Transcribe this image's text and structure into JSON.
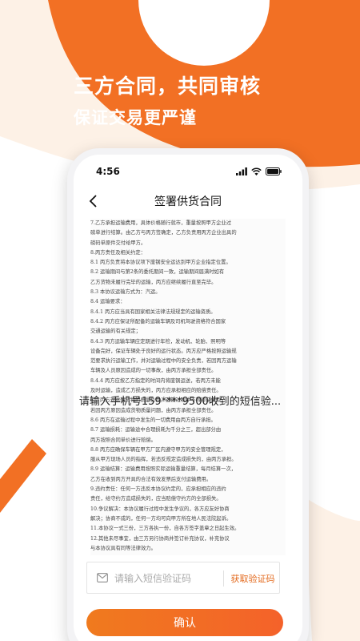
{
  "banner": {
    "headline": "三方合同，共同审核",
    "subline": "保证交易更严谨"
  },
  "status_bar": {
    "time": "4:56"
  },
  "nav": {
    "title": "签署供货合同"
  },
  "document": {
    "lines": [
      "7.乙方承担运输费用，具体价格随行就市，重量按照甲方企业过",
      "磅单进行结算。由乙方与丙方签确定，乙方负责用丙方企业出具的",
      "磅码单原件交付给甲方。",
      "8.丙方责任及相关约定：",
      "8.1 丙方负责将本协议项下废钢安全运达到甲方企业指定位置。",
      "8.2 运输期间与第2条的委托期间一致，运输期间届满时如有",
      "乙方货物未履行完毕的运输，丙方应继续履行直至完毕。",
      "8.3 本协议运输方式为：汽运。",
      "8.4 运输要求：",
      "8.4.1 丙方应当具有国家相关法律法规规定的运输资质。",
      "8.4.2 丙方应保证所配备的运输车辆及司机驾驶资格符合国家",
      "交通运输的有关规定；",
      "8.4.3 丙方运输车辆应定期进行年检，发动机、轮胎、照明等",
      "设备完好，保证车辆处于良好的运行状态。丙方应严格按照运输规",
      "范要求执行运输工作，并对运输过程中的安全负责，若因丙方运输",
      "车辆及人员原因造成的一切事故，由丙方承担全部责任。",
      "8.4.4 丙方应按乙方指定的时间内将废钢运送，若丙方未能",
      "及时运输，造成乙方损失的，丙方应承担相应的赔偿责任。",
      "8.5 丙方对运输货物的质量负责，运输过程中不得掺杂使假，",
      "若因丙方原因造成货物质量问题，由丙方承担全部责任。",
      "8.6 丙方在运输过程中发生的一切费用由丙方自行承担。",
      "8.7 运输损耗：运输途中合理损耗为千分之三，超出部分由",
      "丙方按照合同单价进行赔偿。",
      "8.8 丙方应确保车辆在甲方厂区内遵守甲方的安全管理规定，",
      "服从甲方现场人员的指挥，若违反规定造成损失的，由丙方承担。",
      "8.9 运输结算：运输费用按照实际运输重量结算，每月结算一次，",
      "乙方在收到丙方开具的合法有效发票后支付运输费用。",
      "9.违约责任：任何一方违反本协议约定的，应承担相应的违约",
      "责任，给守约方造成损失的，应当赔偿守约方的全部损失。",
      "10.争议解决：本协议履行过程中发生争议的，各方应友好协商",
      "解决；协商不成的，任何一方均可向甲方所在地人民法院起诉。",
      "11.本协议一式三份，三方各执一份，自各方签字盖章之日起生效。",
      "12.其他未尽事宜，由三方另行协商并签订补充协议，补充协议",
      "与本协议具有同等法律效力。"
    ]
  },
  "sms": {
    "prompt": "请输入手机号159****9500收到的短信验...",
    "placeholder": "请输入短信验证码",
    "get_code_label": "获取验证码"
  },
  "actions": {
    "confirm_label": "确认"
  },
  "colors": {
    "accent": "#f27024",
    "accent_light": "#fdf1e6",
    "link_orange": "#e36a1e"
  },
  "icons": {
    "back": "chevron-left-icon",
    "mail": "mail-icon",
    "signal": "signal-icon",
    "wifi": "wifi-icon",
    "battery": "battery-icon"
  }
}
